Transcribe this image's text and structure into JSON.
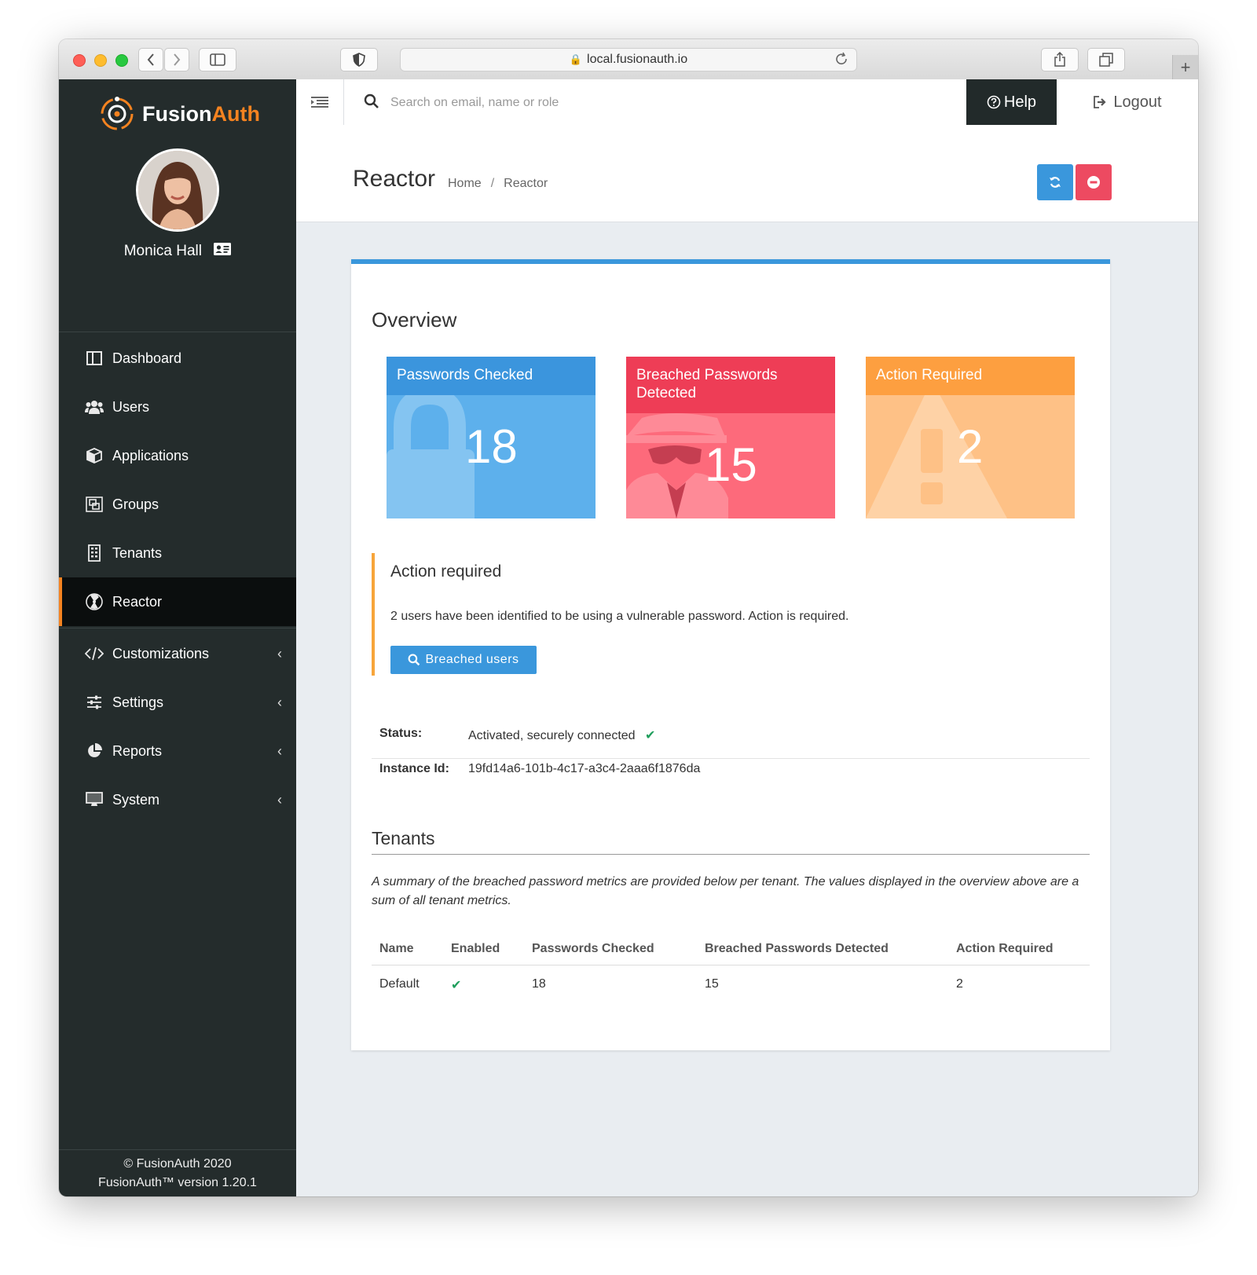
{
  "browser": {
    "url": "local.fusionauth.io"
  },
  "brand": {
    "fusion": "Fusion",
    "auth": "Auth"
  },
  "user": {
    "name": "Monica Hall"
  },
  "nav": [
    {
      "label": "Dashboard",
      "icon": "dashboard-icon"
    },
    {
      "label": "Users",
      "icon": "users-icon"
    },
    {
      "label": "Applications",
      "icon": "cube-icon"
    },
    {
      "label": "Groups",
      "icon": "groups-icon"
    },
    {
      "label": "Tenants",
      "icon": "building-icon"
    },
    {
      "label": "Reactor",
      "icon": "radiation-icon",
      "active": true
    },
    {
      "label": "Customizations",
      "icon": "code-icon",
      "expandable": true
    },
    {
      "label": "Settings",
      "icon": "sliders-icon",
      "expandable": true
    },
    {
      "label": "Reports",
      "icon": "pie-chart-icon",
      "expandable": true
    },
    {
      "label": "System",
      "icon": "monitor-icon",
      "expandable": true
    }
  ],
  "footer": {
    "copyright": "© FusionAuth 2020",
    "version": "FusionAuth™ version 1.20.1"
  },
  "topbar": {
    "search_placeholder": "Search on email, name or role",
    "help": "Help",
    "logout": "Logout"
  },
  "page": {
    "title": "Reactor",
    "breadcrumb": [
      "Home",
      "Reactor"
    ]
  },
  "overview": {
    "title": "Overview",
    "cards": [
      {
        "label": "Passwords Checked",
        "value": "18",
        "color": "#3b95dd"
      },
      {
        "label": "Breached Passwords Detected",
        "value": "15",
        "color": "#ee3d56"
      },
      {
        "label": "Action Required",
        "value": "2",
        "color": "#fd9f40"
      }
    ]
  },
  "action_required": {
    "title": "Action required",
    "text": "2 users have been identified to be using a vulnerable password. Action is required.",
    "button": "Breached users"
  },
  "status": {
    "status_label": "Status:",
    "status_value": "Activated, securely connected",
    "instance_label": "Instance Id:",
    "instance_value": "19fd14a6-101b-4c17-a3c4-2aaa6f1876da"
  },
  "tenants": {
    "title": "Tenants",
    "description": "A summary of the breached password metrics are provided below per tenant. The values displayed in the overview above are a sum of all tenant metrics.",
    "columns": [
      "Name",
      "Enabled",
      "Passwords Checked",
      "Breached Passwords Detected",
      "Action Required"
    ],
    "rows": [
      {
        "name": "Default",
        "enabled": true,
        "checked": "18",
        "breached": "15",
        "action": "2"
      }
    ]
  }
}
